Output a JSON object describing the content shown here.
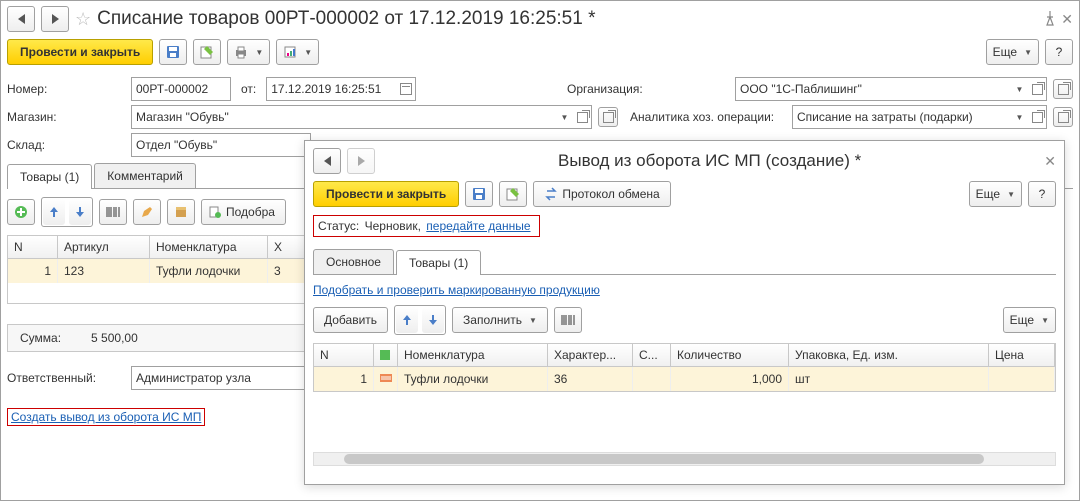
{
  "outer": {
    "title": "Списание товаров 00РТ-000002 от 17.12.2019 16:25:51 *",
    "post_close": "Провести и закрыть",
    "more": "Еще",
    "help": "?",
    "fields": {
      "number_label": "Номер:",
      "number_value": "00РТ-000002",
      "date_label": "от:",
      "date_value": "17.12.2019 16:25:51",
      "org_label": "Организация:",
      "org_value": "ООО \"1С-Паблишинг\"",
      "shop_label": "Магазин:",
      "shop_value": "Магазин \"Обувь\"",
      "analytics_label": "Аналитика хоз. операции:",
      "analytics_value": "Списание на затраты (подарки)",
      "warehouse_label": "Склад:",
      "warehouse_value": "Отдел \"Обувь\""
    },
    "tabs": {
      "goods": "Товары (1)",
      "comment": "Комментарий"
    },
    "tb2": {
      "pick": "Подобра"
    },
    "grid": {
      "head": {
        "n": "N",
        "art": "Артикул",
        "nom": "Номенклатура",
        "char": "Х"
      },
      "row": {
        "n": "1",
        "art": "123",
        "nom": "Туфли лодочки",
        "char": "3"
      }
    },
    "sum_label": "Сумма:",
    "sum_value": "5 500,00",
    "resp_label": "Ответственный:",
    "resp_value": "Администратор узла",
    "create_link": "Создать вывод из оборота ИС МП"
  },
  "inner": {
    "title": "Вывод из оборота ИС МП (создание) *",
    "post_close": "Провести и закрыть",
    "protocol": "Протокол обмена",
    "more": "Еще",
    "help": "?",
    "status_label": "Статус:",
    "status_value": "Черновик,",
    "status_link": "передайте данные",
    "tabs": {
      "main": "Основное",
      "goods": "Товары (1)"
    },
    "pick_link": "Подобрать и проверить маркированную продукцию",
    "add": "Добавить",
    "fill": "Заполнить",
    "more2": "Еще",
    "grid": {
      "head": {
        "n": "N",
        "mark": "",
        "nom": "Номенклатура",
        "char": "Характер...",
        "s": "С...",
        "qty": "Количество",
        "pack": "Упаковка, Ед. изм.",
        "price": "Цена"
      },
      "row": {
        "n": "1",
        "nom": "Туфли лодочки",
        "char": "36",
        "qty": "1,000",
        "pack": "шт"
      }
    }
  }
}
